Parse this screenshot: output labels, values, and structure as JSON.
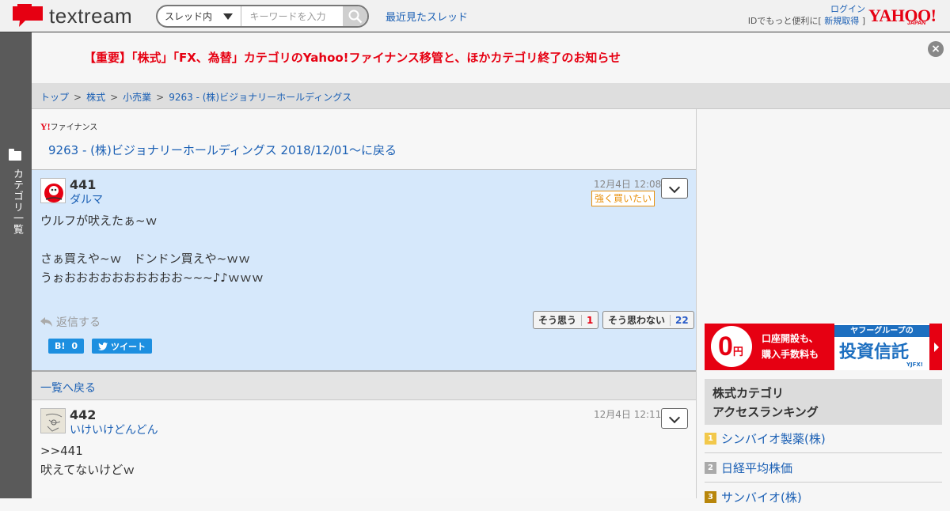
{
  "header": {
    "logo_text": "textream",
    "search_scope": "スレッド内",
    "search_placeholder": "キーワードを入力",
    "recent_threads": "最近見たスレッド",
    "login": "ログイン",
    "id_prefix": "IDでもっと便利に[",
    "register": "新規取得",
    "id_suffix": "]",
    "yahoo": "YAHOO!",
    "yahoo_sub": "JAPAN"
  },
  "sidebar": {
    "categories_label": "カテゴリ一覧"
  },
  "notice": {
    "text": "【重要】「株式」「FX、為替」カテゴリのYahoo!ファイナンス移管と、ほかカテゴリ終了のお知らせ",
    "close": "×"
  },
  "breadcrumb": [
    "トップ",
    "株式",
    "小売業",
    "9263 - (株)ビジョナリーホールディングス"
  ],
  "breadcrumb_sep": ">",
  "thread": {
    "finance_logo_y": "Y!",
    "finance_logo_text": "ファイナンス",
    "back_title": "9263 - (株)ビジョナリーホールディングス 2018/12/01〜に戻る"
  },
  "posts": [
    {
      "number": "441",
      "user": "ダルマ",
      "time": "12月4日 12:08",
      "sentiment": "強く買いたい",
      "line1": "ウルフが吠えたぁ~ｗ",
      "line2": "さぁ買えや~ｗ　ドンドン買えや~ｗｗ",
      "line3": "うぉおおおおおおおおおお~~~♪♪ｗｗｗ",
      "reply": "返信する",
      "agree_label": "そう思う",
      "agree_count": "1",
      "disagree_label": "そう思わない",
      "disagree_count": "22",
      "hatena_label": "B!",
      "hatena_count": "0",
      "tweet_label": "ツイート"
    },
    {
      "number": "442",
      "user": "いけいけどんどん",
      "time": "12月4日 12:11",
      "line1": ">>441",
      "line2": "吠えてないけどｗ"
    }
  ],
  "back_to_list": "一覧へ戻る",
  "ad": {
    "zero": "0",
    "yen": "円",
    "line1": "口座開設も、",
    "line2": "購入手数料も",
    "top": "ヤフーグループの",
    "main": "投資信託",
    "brand": "YJFX!"
  },
  "ranking": {
    "title1": "株式カテゴリ",
    "title2": "アクセスランキング",
    "items": [
      {
        "rank": "1",
        "name": "シンバイオ製薬(株)"
      },
      {
        "rank": "2",
        "name": "日経平均株価"
      },
      {
        "rank": "3",
        "name": "サンバイオ(株)"
      }
    ]
  },
  "colors": {
    "accent": "#e60012",
    "link": "#1a5fb4",
    "post_bg": "#d6e8fb"
  }
}
